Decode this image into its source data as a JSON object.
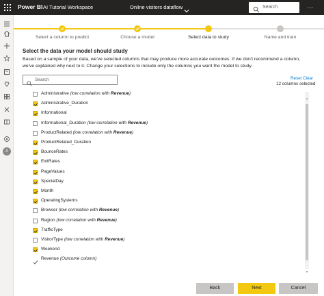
{
  "header": {
    "brand": "Power BI",
    "workspace": "AI Tutorial Workspace",
    "dataflow": "Online visitors dataflow",
    "search_placeholder": "Search",
    "more_label": "..."
  },
  "rail": {
    "icons": [
      "hamburger-icon",
      "home-icon",
      "plus-icon",
      "star-icon",
      "clock-icon",
      "apps-icon",
      "shared-icon",
      "workspaces-icon",
      "deployment-icon",
      "learn-icon",
      "metrics-icon"
    ],
    "avatar_initial": "A"
  },
  "stepper": {
    "steps": [
      {
        "label": "Select a column to predict",
        "state": "done"
      },
      {
        "label": "Choose a model",
        "state": "done"
      },
      {
        "label": "Select data to study",
        "state": "current"
      },
      {
        "label": "Name and train",
        "state": "todo"
      }
    ]
  },
  "main": {
    "title": "Select the data your model should study",
    "description": "Based on a sample of your data, we've selected columns that may produce more accurate outcomes. If we don't recommend a column, we've explained why next to it. Change your selections to include only the columns you want the model to study.",
    "filter_placeholder": "Search",
    "reset_label": "Reset",
    "clear_label": "Clear",
    "selected_count": "12 columns selected"
  },
  "columns": [
    {
      "name": "Administrative",
      "checked": false,
      "note_prefix": "(low correlation with ",
      "note_target": "Revenue",
      "note_suffix": ")"
    },
    {
      "name": "Administrative_Duration",
      "checked": true
    },
    {
      "name": "Informational",
      "checked": true
    },
    {
      "name": "Informational_Duration",
      "checked": false,
      "note_prefix": "(low correlation with ",
      "note_target": "Revenue",
      "note_suffix": ")"
    },
    {
      "name": "ProductRelated",
      "checked": false,
      "note_prefix": "(low correlation with ",
      "note_target": "Revenue",
      "note_suffix": ")"
    },
    {
      "name": "ProductRelated_Duration",
      "checked": true
    },
    {
      "name": "BounceRates",
      "checked": true
    },
    {
      "name": "ExitRates",
      "checked": true
    },
    {
      "name": "PageValues",
      "checked": true
    },
    {
      "name": "SpecialDay",
      "checked": true
    },
    {
      "name": "Month",
      "checked": true
    },
    {
      "name": "OperatingSystems",
      "checked": true
    },
    {
      "name": "Browser",
      "checked": false,
      "note_prefix": "(low correlation with ",
      "note_target": "Revenue",
      "note_suffix": ")"
    },
    {
      "name": "Region",
      "checked": false,
      "note_prefix": "(low correlation with ",
      "note_target": "Revenue",
      "note_suffix": ")"
    },
    {
      "name": "TrafficType",
      "checked": true
    },
    {
      "name": "VisitorType",
      "checked": false,
      "note_prefix": "(low correlation with ",
      "note_target": "Revenue",
      "note_suffix": ")"
    },
    {
      "name": "Weekend",
      "checked": true
    },
    {
      "name": "Revenue",
      "checked": null,
      "note_prefix": "(Outcome column)",
      "note_target": "",
      "note_suffix": ""
    }
  ],
  "footer": {
    "back_label": "Back",
    "next_label": "Next",
    "cancel_label": "Cancel"
  },
  "colors": {
    "accent": "#f2c811",
    "header_bg": "#252423",
    "link": "#0078d4"
  }
}
